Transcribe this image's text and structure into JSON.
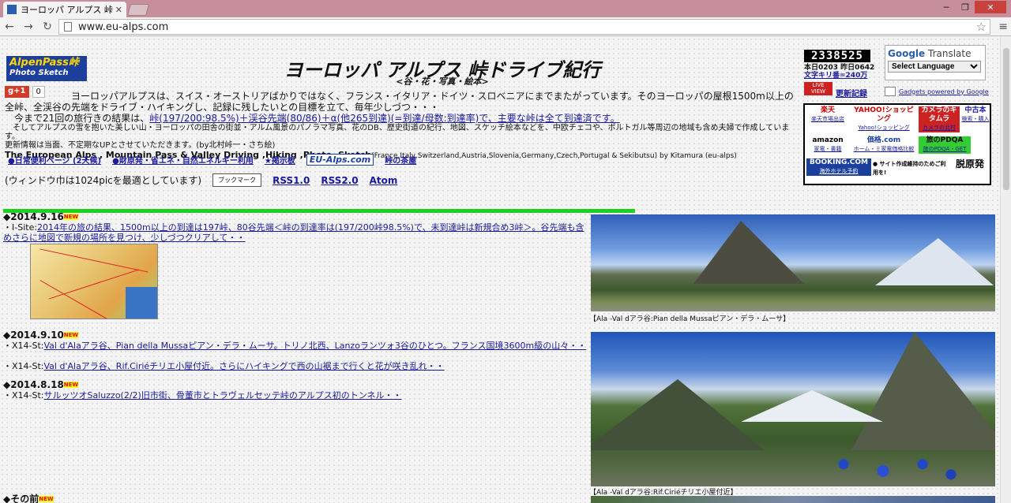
{
  "browser": {
    "tab_title": "ヨーロッパ アルプス 峠ドライブ",
    "url": "www.eu-alps.com"
  },
  "site": {
    "logo_line1": "AlpenPass峠",
    "logo_line2": "Photo Sketch",
    "gplus_label": "g+1",
    "gplus_count": "0",
    "title": "ヨーロッパ アルプス 峠ドライブ紀行",
    "subtitle": "<谷・花・写真・絵本>",
    "intro1": "　　　　　　　ヨーロッパアルプスは、スイス・オーストリアばかりではなく、フランス・イタリア・ドイツ・スロベニアにまでまたがっています。そのヨーロッパの屋根1500m以上の全峠、全渓谷の先端をドライブ・ハイキングし、記録に残したいとの目標を立て、毎年少しづつ・・・",
    "intro2_prefix": "　今まで21回の旅行きの結果は、",
    "intro2_link": "峠(197/200:98.5%)＋渓谷先端(80/86)＋α(他265到達)(=到達/母数:到達率)で、主要な峠は全て到達済です。",
    "intro3": "　そしてアルプスの雪を抱いた美しい山・ヨーロッパの田舎の街並・アルム風景のパノラマ写真、花のDB、歴史街道の紀行、地図、スケッチ絵本などを、中欧チェコや、ポルトガル等周辺の地域も含め夫婦で作成しています。",
    "intro4": "更新情報は当面、不定期なUPとさせていただきます。(by北村峠一・さち絵)",
    "intro_en": "The European Alps , Mountain Pass & Valley Driving ,Hiking ,Photo ,Sketch",
    "intro_en_small": "(France,Italy,Switzerland,Austria,Slovenia,Germany,Czech,Portugal & Sekibutsu) by Kitamura (eu-alps)"
  },
  "links": {
    "l1": "●日常便利ページ (2天候)",
    "l2": "●財原発・省エネ・自然エネルギー利用",
    "l3": "★掲示板",
    "badge": "EU-Alps.com",
    "l4": "峠の茶屋"
  },
  "window_row": {
    "note": "(ウィンドウ巾は1024picを最適としています)",
    "bookmark": "ブックマーク",
    "rss1": "RSS1.0",
    "rss2": "RSS2.0",
    "atom": "Atom"
  },
  "entries": [
    {
      "date": "◆2014.9.16",
      "prefix": "・I-Site:",
      "link": "2014年の旅の結果、1500m以上の到達は197峠、80谷先端＜峠の到達率は(197/200峠98.5%)で、未到達峠は新規合め3峠＞。谷先端も含めさらに地図で新規の場所を見つけ、少しづつクリアして・・"
    },
    {
      "date": "◆2014.9.10",
      "prefix": "・X14-St:",
      "link": "Val d'Alaアラ谷、Pian della Mussaピアン・デラ・ムーサ。トリノ北西、Lanzoランツォ3谷のひとつ。フランス国境3600m級の山々・・"
    },
    {
      "date": "",
      "prefix": "・X14-St:",
      "link": "Val d'Alaアラ谷、Rif.Ciriéチリエ小屋付近。さらにハイキングで西の山裾まで行くと花が咲き乱れ・・"
    },
    {
      "date": "◆2014.8.18",
      "prefix": "・X14-St:",
      "link": "サルッツオSaluzzo(2/2)旧市街、骨董市とトラヴェルセッテ峠のアルプス初のトンネル・・"
    },
    {
      "date": "◆その前",
      "prefix": "",
      "link": ""
    }
  ],
  "new_badge": "NEW",
  "captions": {
    "photo1": "【Ala -Val dアラ谷:Pian della Mussaピアン・デラ・ムーサ】",
    "photo2": "【Ala -Val dアラ谷:Rif.Ciriéチリエ小屋付近】"
  },
  "sidebar": {
    "counter": "2338525",
    "stats_line1": "本日0203 昨日0642",
    "stats_line2": "文字キリ番=240万",
    "update_link": "更新記録",
    "gt_title_prefix": "Google",
    "gt_title": "Translate",
    "gt_select": "Select Language",
    "gt_powered": "Gadgets powered by Google",
    "ads": {
      "a1": "楽天",
      "a1s": "楽天市場出店",
      "a2": "YAHOO!ショッピング",
      "a2s": "Yahoo!ショッピング",
      "a3": "カメラのキタムラ",
      "a3s": "カメラの北村",
      "a4": "中古本",
      "a4s": "検索・購入",
      "a5": "amazon",
      "a5s": "家電・書籍",
      "a6": "価格.com",
      "a6s": "ホーム・ミ家電価格比較",
      "a7": "旅のPDQA",
      "a7s": "旅のPDQA・GET",
      "a8": "BOOKING.COM",
      "a8s": "海外ホテル予約",
      "a9": "● サイト作成維持のためご利用を!",
      "a10": "脱原発"
    }
  }
}
